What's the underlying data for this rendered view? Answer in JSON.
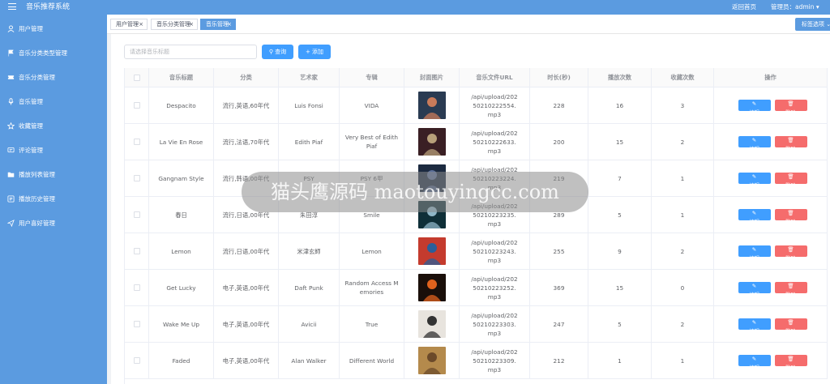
{
  "header": {
    "app_title": "音乐推荐系统",
    "home_link": "返回首页",
    "admin_label": "管理员：admin ▾"
  },
  "sidebar": {
    "items": [
      {
        "label": "用户管理",
        "icon": "user-icon"
      },
      {
        "label": "音乐分类类型管理",
        "icon": "flag-icon"
      },
      {
        "label": "音乐分类管理",
        "icon": "ticket-icon"
      },
      {
        "label": "音乐管理",
        "icon": "mic-icon"
      },
      {
        "label": "收藏管理",
        "icon": "star-icon"
      },
      {
        "label": "评论管理",
        "icon": "comment-icon"
      },
      {
        "label": "播放列表管理",
        "icon": "folder-icon"
      },
      {
        "label": "播放历史管理",
        "icon": "history-icon"
      },
      {
        "label": "用户喜好管理",
        "icon": "send-icon"
      }
    ]
  },
  "tabs": [
    {
      "label": "用户管理",
      "close": "×",
      "active": false
    },
    {
      "label": "音乐分类管理",
      "close": "×",
      "active": false
    },
    {
      "label": "音乐管理",
      "close": "×",
      "active": true
    }
  ],
  "tab_options_label": "标签选项 ⌄",
  "toolbar": {
    "search_placeholder": "请选择音乐标题",
    "query_label": "查询",
    "add_label": "添加"
  },
  "table": {
    "columns": [
      "音乐标题",
      "分类",
      "艺术家",
      "专辑",
      "封面图片",
      "音乐文件URL",
      "时长(秒)",
      "播放次数",
      "收藏次数",
      "操作"
    ],
    "edit_label": "编辑",
    "delete_label": "删除",
    "rows": [
      {
        "title": "Despacito",
        "category": "流行,英语,60年代",
        "artist": "Luis Fonsi",
        "album": "VIDA",
        "url": "/api/upload/20250210222554.mp3",
        "duration": "228",
        "plays": "16",
        "favorites": "3"
      },
      {
        "title": "La Vie En Rose",
        "category": "流行,法语,70年代",
        "artist": "Edith Piaf",
        "album": "Very Best of Edith Piaf",
        "url": "/api/upload/20250210222633.mp3",
        "duration": "200",
        "plays": "15",
        "favorites": "2"
      },
      {
        "title": "Gangnam Style",
        "category": "流行,韩语,00年代",
        "artist": "PSY",
        "album": "PSY 6甲",
        "url": "/api/upload/20250210223224.mp3",
        "duration": "219",
        "plays": "7",
        "favorites": "1"
      },
      {
        "title": "春日",
        "category": "流行,日语,00年代",
        "artist": "朱田淳",
        "album": "Smile",
        "url": "/api/upload/20250210223235.mp3",
        "duration": "289",
        "plays": "5",
        "favorites": "1"
      },
      {
        "title": "Lemon",
        "category": "流行,日语,00年代",
        "artist": "米津玄師",
        "album": "Lemon",
        "url": "/api/upload/20250210223243.mp3",
        "duration": "255",
        "plays": "9",
        "favorites": "2"
      },
      {
        "title": "Get Lucky",
        "category": "电子,英语,00年代",
        "artist": "Daft Punk",
        "album": "Random Access Memories",
        "url": "/api/upload/20250210223252.mp3",
        "duration": "369",
        "plays": "15",
        "favorites": "0"
      },
      {
        "title": "Wake Me Up",
        "category": "电子,英语,00年代",
        "artist": "Avicii",
        "album": "True",
        "url": "/api/upload/20250210223303.mp3",
        "duration": "247",
        "plays": "5",
        "favorites": "2"
      },
      {
        "title": "Faded",
        "category": "电子,英语,00年代",
        "artist": "Alan Walker",
        "album": "Different World",
        "url": "/api/upload/20250210223309.mp3",
        "duration": "212",
        "plays": "1",
        "favorites": "1"
      }
    ]
  },
  "watermark": "猫头鹰源码 maotouyingcc.com",
  "colors": {
    "primary": "#409eff",
    "danger": "#f56c6c",
    "sidebar": "#5b9be0"
  }
}
